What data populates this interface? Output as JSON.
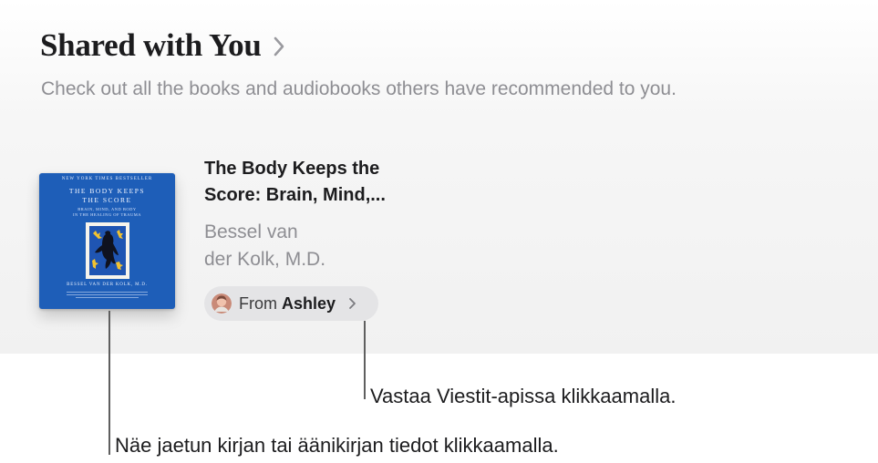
{
  "section": {
    "title": "Shared with You",
    "subtitle": "Check out all the books and audiobooks others have recommended to you."
  },
  "book": {
    "title": "The Body Keeps the\nScore: Brain, Mind,...",
    "author": "Bessel van\nder Kolk, M.D.",
    "cover": {
      "top_line": "NEW YORK TIMES BESTSELLER",
      "title": "THE BODY KEEPS\nTHE SCORE",
      "subtitle": "BRAIN, MIND, AND BODY\nIN THE HEALING OF TRAUMA",
      "author": "BESSEL VAN DER KOLK, M.D.",
      "background_color": "#1e5eb8"
    }
  },
  "shared_from": {
    "prefix": "From",
    "name": "Ashley",
    "avatar_icon": "person-avatar",
    "chevron_icon": "chevron-right-icon"
  },
  "callouts": {
    "reply": "Vastaa Viestit-apissa klikkaamalla.",
    "details": "Näe jaetun kirjan tai äänikirjan tiedot klikkaamalla."
  },
  "colors": {
    "accent_cover": "#1e5eb8",
    "secondary_text": "#8e8e93",
    "pill_background": "#e4e4e6"
  }
}
